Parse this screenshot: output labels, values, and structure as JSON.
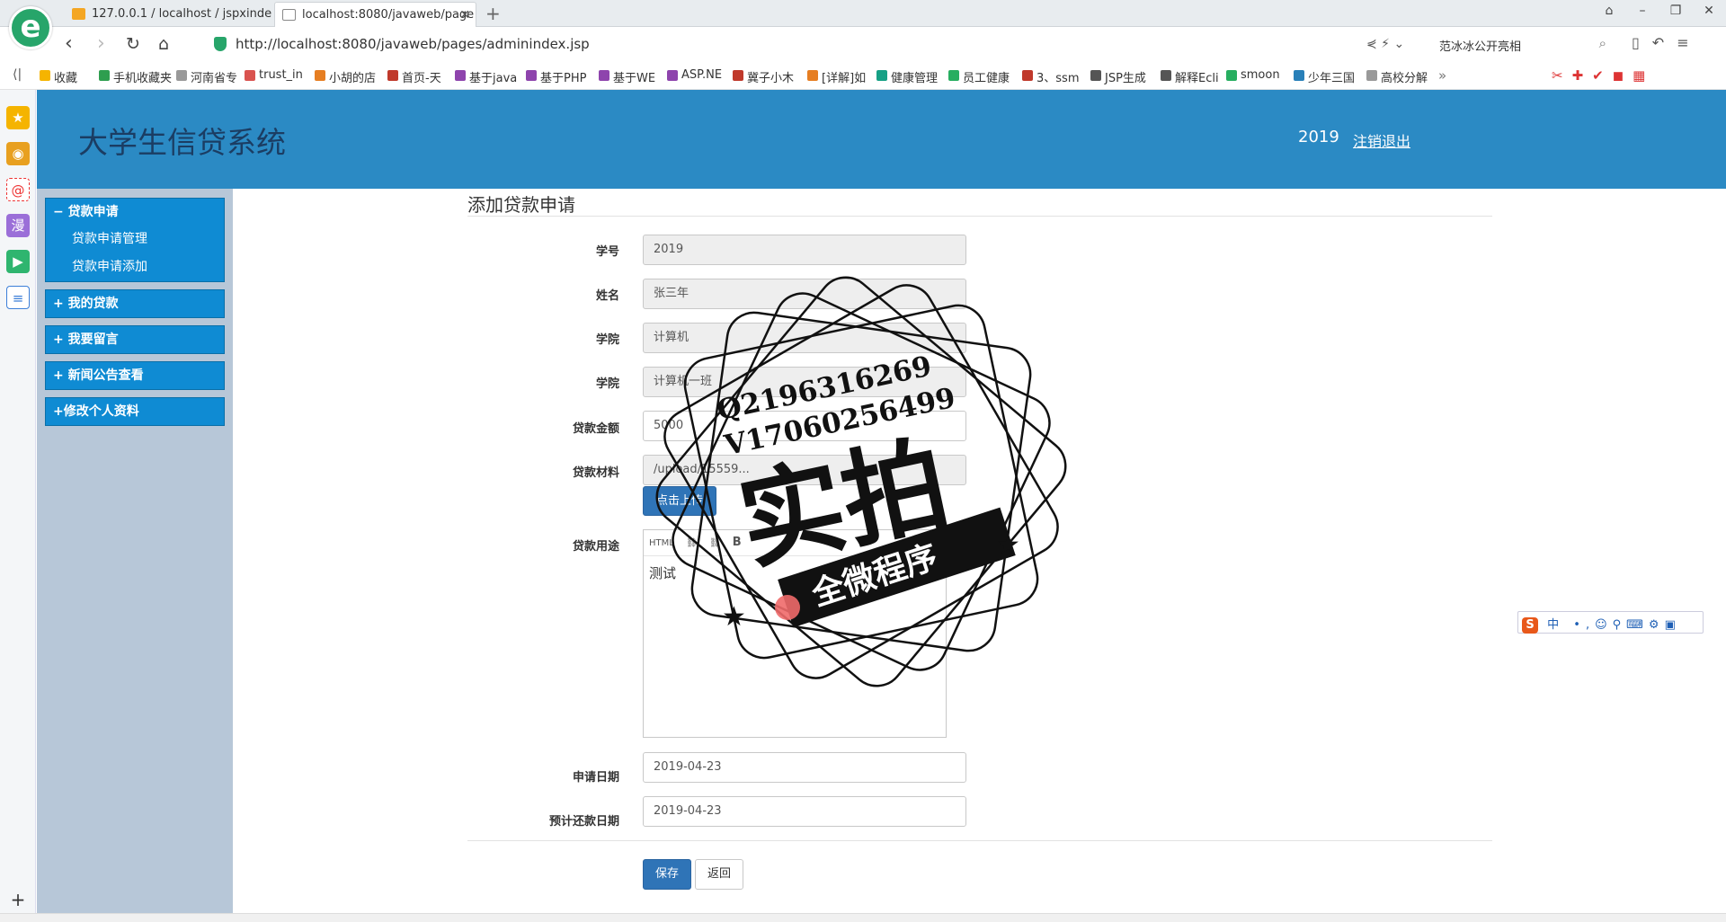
{
  "browser": {
    "tabs": [
      {
        "label": "127.0.0.1 / localhost / jspxinde"
      },
      {
        "label": "localhost:8080/javaweb/page"
      }
    ],
    "url": "http://localhost:8080/javaweb/pages/adminindex.jsp",
    "search_text": "范冰冰公开亮相",
    "bookmarks": [
      {
        "label": "收藏",
        "color": "#f5b400"
      },
      {
        "label": "手机收藏夹",
        "color": "#2e9e4f"
      },
      {
        "label": "河南省专",
        "color": "#999999"
      },
      {
        "label": "trust_in",
        "color": "#d9534f"
      },
      {
        "label": "小胡的店",
        "color": "#e67e22"
      },
      {
        "label": "首页-天",
        "color": "#c0392b"
      },
      {
        "label": "基于java",
        "color": "#8e44ad"
      },
      {
        "label": "基于PHP",
        "color": "#8e44ad"
      },
      {
        "label": "基于WE",
        "color": "#8e44ad"
      },
      {
        "label": "ASP.NE",
        "color": "#8e44ad"
      },
      {
        "label": "冀子小木",
        "color": "#c0392b"
      },
      {
        "label": "[详解]如",
        "color": "#e67e22"
      },
      {
        "label": "健康管理",
        "color": "#16a085"
      },
      {
        "label": "员工健康",
        "color": "#27ae60"
      },
      {
        "label": "3、ssm",
        "color": "#c0392b"
      },
      {
        "label": "JSP生成",
        "color": "#555555"
      },
      {
        "label": "解释Ecli",
        "color": "#555555"
      },
      {
        "label": "smoon",
        "color": "#27ae60"
      },
      {
        "label": "少年三国",
        "color": "#2980b9"
      },
      {
        "label": "高校分解",
        "color": "#999999"
      }
    ]
  },
  "app": {
    "title": "大学生信贷系统",
    "user": "2019",
    "logout": "注销退出"
  },
  "sidebar": {
    "menus": [
      {
        "label": "− 贷款申请",
        "items": [
          "贷款申请管理",
          "贷款申请添加"
        ]
      },
      {
        "label": "+ 我的贷款"
      },
      {
        "label": "+ 我要留言"
      },
      {
        "label": "+ 新闻公告查看"
      },
      {
        "label": "+修改个人资料"
      }
    ]
  },
  "form": {
    "heading": "添加贷款申请",
    "fields": [
      {
        "label": "学号",
        "value": "2019"
      },
      {
        "label": "姓名",
        "value": "张三年"
      },
      {
        "label": "学院",
        "value": "计算机"
      },
      {
        "label": "学院",
        "value": "计算机一班"
      },
      {
        "label": "贷款金额",
        "value": "5000"
      },
      {
        "label": "贷款材料",
        "value": "/upload/15559..."
      }
    ],
    "upload_button": "点击上传",
    "purpose_label": "贷款用途",
    "editor_toolbar": [
      "HTML",
      "B"
    ],
    "purpose_text": "测试",
    "apply_date_label": "申请日期",
    "apply_date": "2019-04-23",
    "repay_date_label": "预计还款日期",
    "repay_date": "2019-04-23",
    "save_button": "保存",
    "back_button": "返回"
  },
  "watermark": {
    "line1": "Q2196316269",
    "line2": "V17060256499",
    "big": "实拍",
    "ribbon": "全微程序"
  },
  "ime": {
    "logo": "S",
    "mode": "中"
  }
}
